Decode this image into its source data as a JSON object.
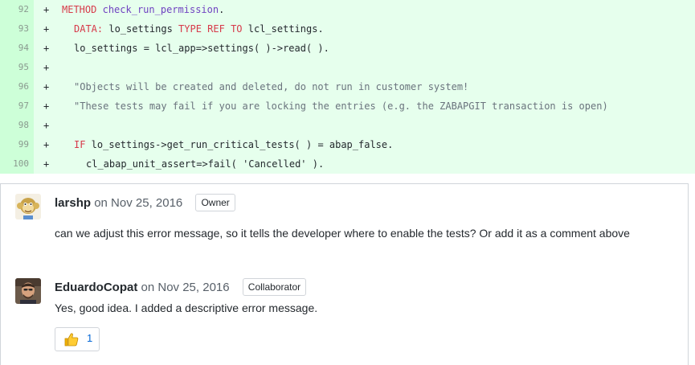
{
  "diff": {
    "lines": [
      {
        "num": "92",
        "mark": "+",
        "code": "METHOD check_run_permission."
      },
      {
        "num": "93",
        "mark": "+",
        "code": "DATA: lo_settings TYPE REF TO lcl_settings."
      },
      {
        "num": "94",
        "mark": "+",
        "code": "lo_settings = lcl_app=>settings( )->read( )."
      },
      {
        "num": "95",
        "mark": "+",
        "code": ""
      },
      {
        "num": "96",
        "mark": "+",
        "code": "\"Objects will be created and deleted, do not run in customer system!"
      },
      {
        "num": "97",
        "mark": "+",
        "code": "\"These tests may fail if you are locking the entries (e.g. the ZABAPGIT transaction is open)"
      },
      {
        "num": "98",
        "mark": "+",
        "code": ""
      },
      {
        "num": "99",
        "mark": "+",
        "code": "IF lo_settings->get_run_critical_tests( ) = abap_false."
      },
      {
        "num": "100",
        "mark": "+",
        "code": "cl_abap_unit_assert=>fail( 'Cancelled' )."
      }
    ],
    "tokens": {
      "method_kw": "METHOD",
      "method_name": "check_run_permission",
      "method_end": ".",
      "data_kw": "DATA:",
      "var": " lo_settings ",
      "type_ref_to": "TYPE REF TO",
      "type_name": " lcl_settings.",
      "line94": "lo_settings = lcl_app=>settings( )->read( ).",
      "line96": "\"Objects will be created and deleted, do not run in customer system!",
      "line97": "\"These tests may fail if you are locking the entries (e.g. the ZABAPGIT transaction is open)",
      "if_kw": "IF",
      "line99_rest": " lo_settings->get_run_critical_tests( ) = abap_false.",
      "line100": "cl_abap_unit_assert=>fail( 'Cancelled' )."
    }
  },
  "comments": [
    {
      "author": "larshp",
      "date": "on Nov 25, 2016",
      "role": "Owner",
      "body": "can we adjust this error message, so it tells the developer where to enable the tests? Or add it as a comment above",
      "avatar_icon": "monkey-avatar-icon"
    },
    {
      "author": "EduardoCopat",
      "date": "on Nov 25, 2016",
      "role": "Collaborator",
      "body": "Yes, good idea. I added a descriptive error message.",
      "avatar_icon": "person-avatar-icon",
      "reactions": [
        {
          "icon": "thumbs-up-icon",
          "count": "1"
        }
      ]
    }
  ],
  "colors": {
    "diff_bg": "#e6ffed",
    "line_number_bg": "#cdffd8",
    "keyword": "#d73a49",
    "comment": "#6a737d",
    "function": "#6f42c1",
    "link": "#0366d6"
  }
}
